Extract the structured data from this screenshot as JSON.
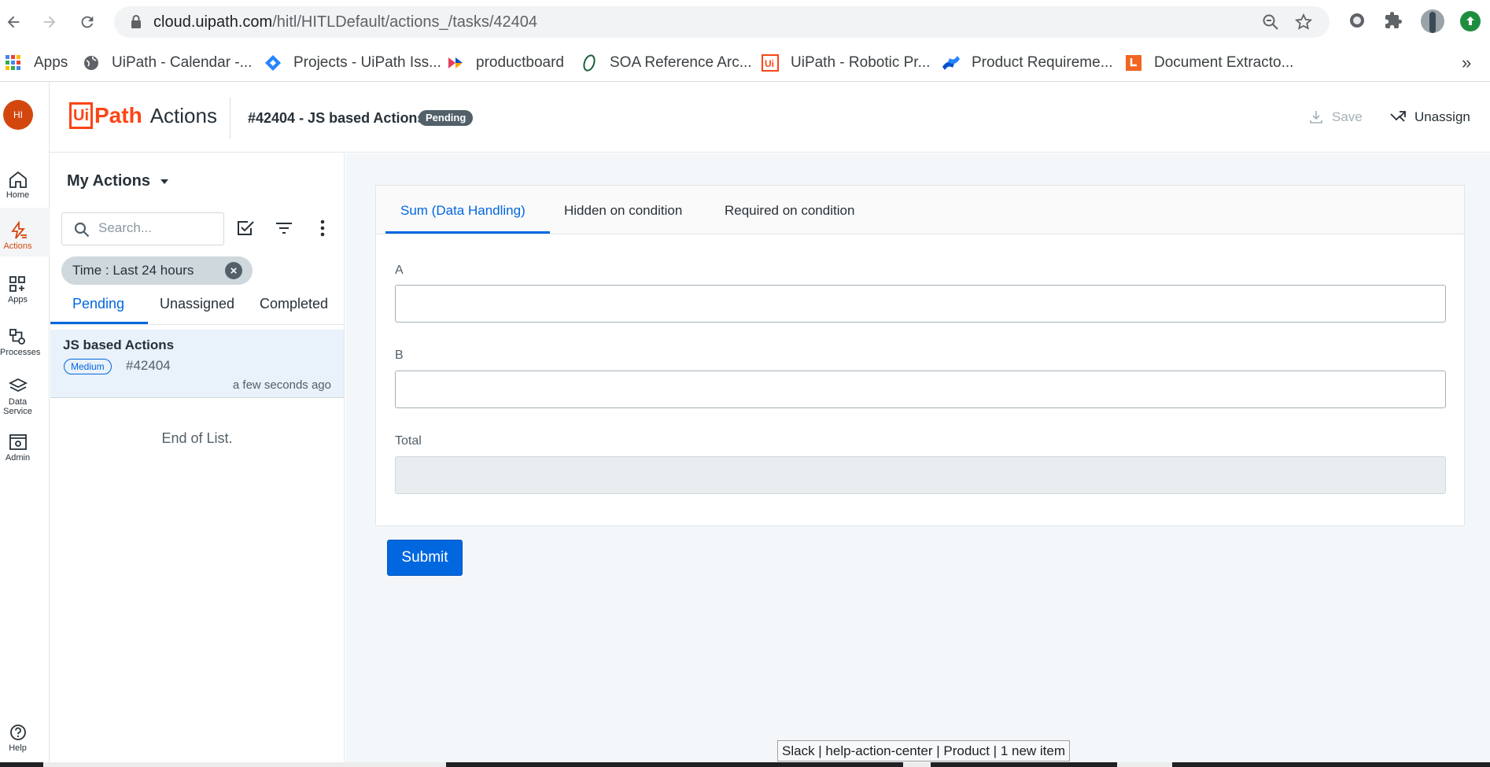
{
  "browser": {
    "url_host": "cloud.uipath.com",
    "url_path": "/hitl/HITLDefault/actions_/tasks/42404",
    "bookmarks": [
      {
        "label": "Apps",
        "icon": "apps-grid-icon"
      },
      {
        "label": "UiPath - Calendar -...",
        "icon": "globe-icon"
      },
      {
        "label": "Projects - UiPath Iss...",
        "icon": "jira-icon"
      },
      {
        "label": "productboard",
        "icon": "productboard-icon"
      },
      {
        "label": "SOA Reference Arc...",
        "icon": "opengroup-icon"
      },
      {
        "label": "UiPath - Robotic Pr...",
        "icon": "uipath-icon"
      },
      {
        "label": "Product Requireme...",
        "icon": "confluence-icon"
      },
      {
        "label": "Document Extracto...",
        "icon": "document-icon"
      }
    ],
    "more_bookmarks": "»"
  },
  "rail": {
    "avatar_initials": "HI",
    "items": [
      {
        "label": "Home",
        "icon": "home-icon"
      },
      {
        "label": "Actions",
        "icon": "actions-icon"
      },
      {
        "label": "Apps",
        "icon": "apps-icon"
      },
      {
        "label": "Processes",
        "icon": "processes-icon"
      },
      {
        "label_line1": "Data",
        "label_line2": "Service",
        "icon": "data-service-icon"
      },
      {
        "label": "Admin",
        "icon": "admin-icon"
      },
      {
        "label": "Help",
        "icon": "help-icon"
      }
    ],
    "accent": "#d3470f"
  },
  "header": {
    "logo_ui": "Ui",
    "logo_path": "Path",
    "product": "Actions",
    "task_title": "#42404 - JS based Actions",
    "status": "Pending",
    "save_label": "Save",
    "unassign_label": "Unassign"
  },
  "list": {
    "title": "My Actions",
    "search_placeholder": "Search...",
    "filter_chip": "Time : Last 24 hours",
    "tabs": [
      "Pending",
      "Unassigned",
      "Completed"
    ],
    "active_tab": "Pending",
    "tasks": [
      {
        "title": "JS based Actions",
        "priority": "Medium",
        "id": "#42404",
        "time": "a few seconds ago"
      }
    ],
    "end_text": "End of List."
  },
  "form": {
    "tabs": [
      "Sum (Data Handling)",
      "Hidden on condition",
      "Required on condition"
    ],
    "active_tab": "Sum (Data Handling)",
    "fields": [
      {
        "label": "A",
        "value": ""
      },
      {
        "label": "B",
        "value": ""
      },
      {
        "label": "Total",
        "value": ""
      }
    ],
    "submit_label": "Submit"
  },
  "tooltip": "Slack | help-action-center | Product | 1 new item",
  "colors": {
    "primary": "#0067df",
    "brand": "#fa4616"
  }
}
